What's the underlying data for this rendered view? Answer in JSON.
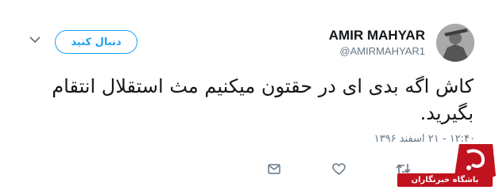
{
  "user": {
    "display_name": "AMIR MAHYAR",
    "handle": "@AMIRMAHYAR1"
  },
  "follow_button": {
    "label": "دنبال کنید"
  },
  "tweet": {
    "text": "کاش اگه بدی ای در حقتون میکنیم مث استقلال انتقام بگیرید.",
    "timestamp": "۱۲:۴۰ - ۲۱ اسفند ۱۳۹۶"
  },
  "actions": [
    "reply-icon",
    "retweet-icon",
    "like-icon",
    "message-icon"
  ],
  "watermark": {
    "label": "باشگاه خبرنگاران"
  },
  "colors": {
    "accent": "#1da1f2",
    "text": "#14171a",
    "secondary": "#657786",
    "watermark_red": "#c1121f"
  }
}
